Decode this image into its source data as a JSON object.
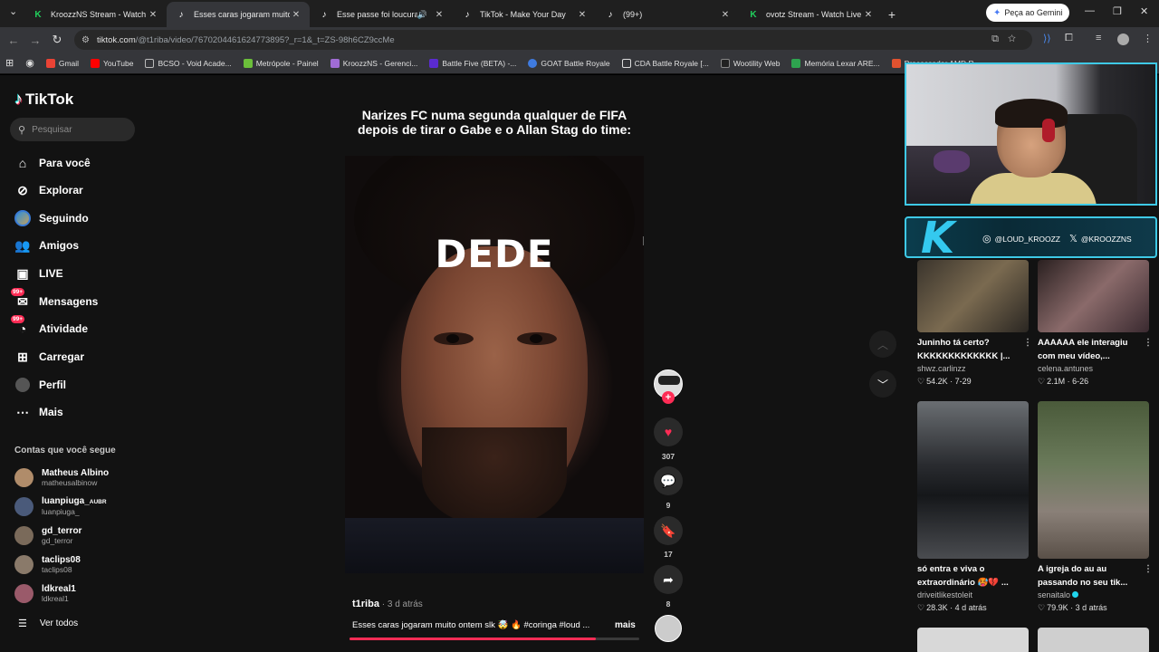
{
  "browser": {
    "tabs": [
      {
        "title": "KroozzNS Stream - Watch Live",
        "favicon": "kick-icon",
        "active": false
      },
      {
        "title": "Esses caras jogaram muito ontem",
        "favicon": "tiktok-icon",
        "active": true
      },
      {
        "title": "Esse passe foi loucura - Co",
        "favicon": "tiktok-icon",
        "active": false,
        "audio": true
      },
      {
        "title": "TikTok - Make Your Day",
        "favicon": "tiktok-icon",
        "active": false
      },
      {
        "title": "(99+)",
        "favicon": "tiktok-icon",
        "active": false
      },
      {
        "title": "ovotz Stream - Watch Live on K",
        "favicon": "kick-icon",
        "active": false
      }
    ],
    "gemini_button": "Peça ao Gemini",
    "url_host": "tiktok.com",
    "url_path": "/@t1riba/video/7670204461624773895?_r=1&_t=ZS-98h6CZ9ccMe",
    "bookmarks": [
      {
        "label": "Gmail",
        "color": "#ea4335"
      },
      {
        "label": "YouTube",
        "color": "#ff0000"
      },
      {
        "label": "BCSO - Void Acade...",
        "color": "#888888"
      },
      {
        "label": "Metrópole - Painel",
        "color": "#6bbf3a"
      },
      {
        "label": "KroozzNS - Gerenci...",
        "color": "#a06cd5"
      },
      {
        "label": "Battle Five (BETA) -...",
        "color": "#5b2bd0"
      },
      {
        "label": "GOAT Battle Royale",
        "color": "#3f7be0"
      },
      {
        "label": "CDA Battle Royale [...",
        "color": "#d8d8d8"
      },
      {
        "label": "Wootility Web",
        "color": "#222222"
      },
      {
        "label": "Memória Lexar ARE...",
        "color": "#2ea44f"
      },
      {
        "label": "Processador AMD R...",
        "color": "#e0522f"
      }
    ]
  },
  "tiktok": {
    "logo": "TikTok",
    "search_placeholder": "Pesquisar",
    "nav": [
      {
        "label": "Para você",
        "icon": "home-icon"
      },
      {
        "label": "Explorar",
        "icon": "compass-icon"
      },
      {
        "label": "Seguindo",
        "icon": "following-avatar-icon"
      },
      {
        "label": "Amigos",
        "icon": "friends-icon"
      },
      {
        "label": "LIVE",
        "icon": "live-icon"
      },
      {
        "label": "Mensagens",
        "icon": "messages-icon",
        "badge": "99+"
      },
      {
        "label": "Atividade",
        "icon": "activity-icon",
        "badge": "99+"
      },
      {
        "label": "Carregar",
        "icon": "upload-icon"
      },
      {
        "label": "Perfil",
        "icon": "profile-icon"
      },
      {
        "label": "Mais",
        "icon": "more-icon"
      }
    ],
    "following_title": "Contas que você segue",
    "following": [
      {
        "name": "Matheus Albino",
        "user": "matheusalbinow"
      },
      {
        "name": "luanpiuga_",
        "suffix": "AUBR",
        "user": "luanpiuga_"
      },
      {
        "name": "gd_terror",
        "user": "gd_terror"
      },
      {
        "name": "taclips08",
        "user": "taclips08"
      },
      {
        "name": "ldkreal1",
        "user": "ldkreal1"
      }
    ],
    "see_all": "Ver todos"
  },
  "video": {
    "caption_line1": "Narizes FC numa segunda qualquer de FIFA",
    "caption_line2": "depois de tirar o Gabe e o Allan Stag do time:",
    "overlay_text": "DEDE",
    "author": "t1riba",
    "posted": " · 3 d atrás",
    "description": "Esses caras jogaram muito ontem slk 🤯 🔥 #coringa #loud ...",
    "more_label": "mais",
    "progress_percent": 85,
    "likes": "307",
    "comments": "9",
    "saves": "17",
    "shares": "8"
  },
  "stream_overlay": {
    "instagram": "@LOUD_KROOZZ",
    "x": "@KROOZZNS",
    "accent": "#3ec9e6"
  },
  "recommended": [
    {
      "title": "Juninho tá certo? KKKKKKKKKKKKK |...",
      "author": "shwz.carlinzz",
      "likes": "54.2K",
      "date": "7-29"
    },
    {
      "title": "AAAAAA ele interagiu com meu vídeo,...",
      "author": "celena.antunes",
      "likes": "2.1M",
      "date": "6-26"
    },
    {
      "title": "só entra e viva o extraordinário 🥵💔 ...",
      "author": "driveitlikestoleit",
      "likes": "28.3K",
      "date": "4 d atrás"
    },
    {
      "title": "A igreja do au au passando no seu tik...",
      "author": "senaitalo",
      "verified": true,
      "likes": "79.9K",
      "date": "3 d atrás"
    }
  ]
}
